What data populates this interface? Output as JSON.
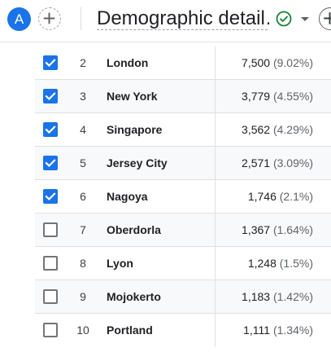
{
  "header": {
    "avatar_letter": "A",
    "title": "Demographic detail…"
  },
  "colors": {
    "accent": "#1a73e8",
    "success": "#188038"
  },
  "icons": {
    "add_comparison": "plus-icon",
    "status": "check-circle-icon",
    "status_menu": "caret-down-icon",
    "checkbox": "checkmark-icon"
  },
  "table": {
    "rows": [
      {
        "rank": "2",
        "city": "London",
        "value": "7,500",
        "pct": "(9.02%)",
        "checked": true
      },
      {
        "rank": "3",
        "city": "New York",
        "value": "3,779",
        "pct": "(4.55%)",
        "checked": true
      },
      {
        "rank": "4",
        "city": "Singapore",
        "value": "3,562",
        "pct": "(4.29%)",
        "checked": true
      },
      {
        "rank": "5",
        "city": "Jersey City",
        "value": "2,571",
        "pct": "(3.09%)",
        "checked": true
      },
      {
        "rank": "6",
        "city": "Nagoya",
        "value": "1,746",
        "pct": "(2.1%)",
        "checked": true
      },
      {
        "rank": "7",
        "city": "Oberdorla",
        "value": "1,367",
        "pct": "(1.64%)",
        "checked": false
      },
      {
        "rank": "8",
        "city": "Lyon",
        "value": "1,248",
        "pct": "(1.5%)",
        "checked": false
      },
      {
        "rank": "9",
        "city": "Mojokerto",
        "value": "1,183",
        "pct": "(1.42%)",
        "checked": false
      },
      {
        "rank": "10",
        "city": "Portland",
        "value": "1,111",
        "pct": "(1.34%)",
        "checked": false
      }
    ]
  }
}
